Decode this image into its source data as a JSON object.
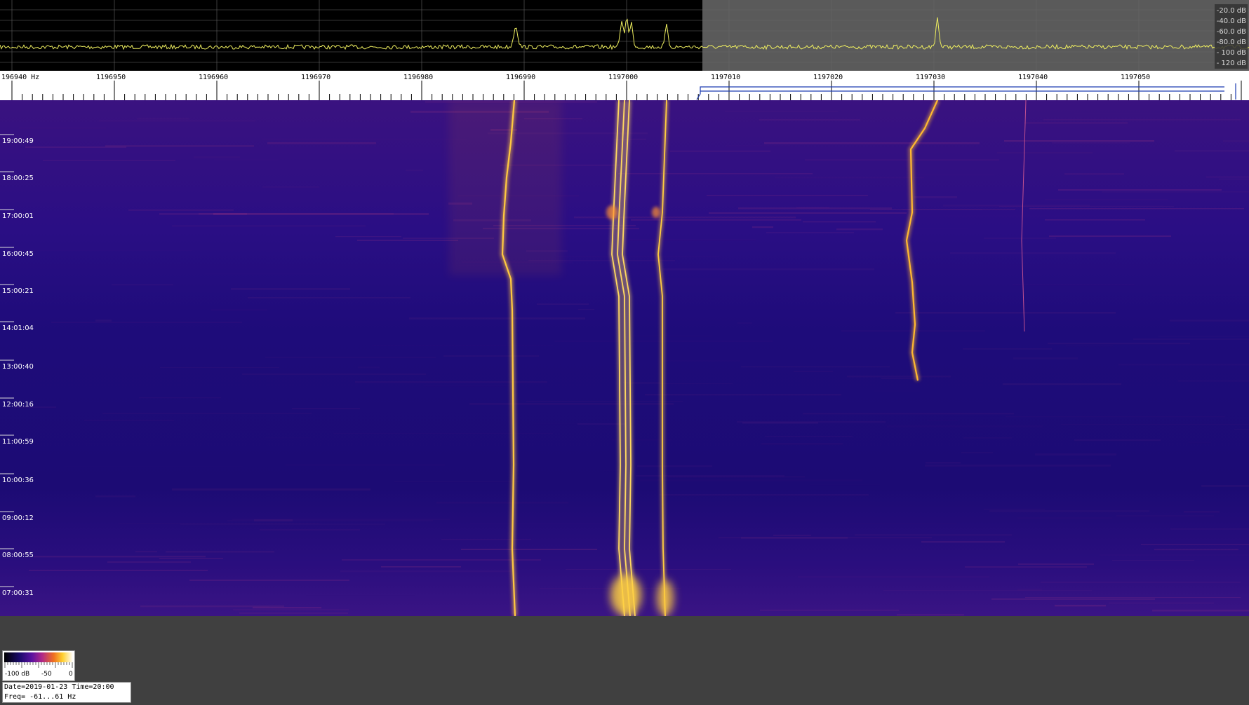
{
  "spectrum": {
    "db_scale": [
      "-20.0 dB",
      "-40.0 dB",
      "-60.0 dB",
      "-80.0 dB",
      "- 100 dB",
      "- 120 dB"
    ]
  },
  "ruler": {
    "freq_labels": [
      "196940 Hz",
      "1196950",
      "1196960",
      "1196970",
      "1196980",
      "1196990",
      "1197000",
      "1197010",
      "1197020",
      "1197030",
      "1197040",
      "1197050"
    ]
  },
  "waterfall": {
    "time_labels": [
      "19:00:49",
      "18:00:25",
      "17:00:01",
      "16:00:45",
      "15:00:21",
      "14:01:04",
      "13:00:40",
      "12:00:16",
      "11:00:59",
      "10:00:36",
      "09:00:12",
      "08:00:55",
      "07:00:31"
    ]
  },
  "colorbar": {
    "labels": [
      "-100 dB",
      "-50",
      "0"
    ]
  },
  "info": {
    "line1": "Date=2019-01-23 Time=20:00",
    "line2": "Freq= -61...61 Hz"
  },
  "colors": {
    "trace": "#f0f060",
    "waterfall_bg": "#1a0a6a",
    "signal": "#ffd040"
  }
}
